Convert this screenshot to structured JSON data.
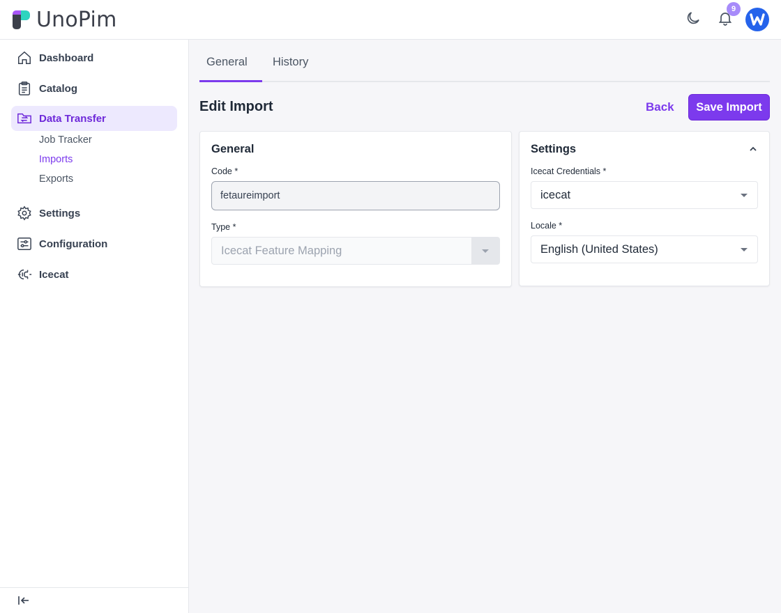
{
  "app": {
    "brand": "UnoPim",
    "notifications_count": "9"
  },
  "sidebar": {
    "items": [
      {
        "label": "Dashboard",
        "icon": "home-icon"
      },
      {
        "label": "Catalog",
        "icon": "clipboard-list-icon"
      },
      {
        "label": "Data Transfer",
        "icon": "folder-transfer-icon",
        "active": true
      },
      {
        "label": "Settings",
        "icon": "gear-icon"
      },
      {
        "label": "Configuration",
        "icon": "sliders-icon"
      },
      {
        "label": "Icecat",
        "icon": "icecat-plug-icon"
      }
    ],
    "sub_items": [
      {
        "label": "Job Tracker"
      },
      {
        "label": "Imports",
        "active": true
      },
      {
        "label": "Exports"
      }
    ]
  },
  "tabs": [
    {
      "label": "General",
      "active": true
    },
    {
      "label": "History"
    }
  ],
  "page": {
    "title": "Edit Import",
    "back_label": "Back",
    "save_label": "Save Import"
  },
  "general_card": {
    "title": "General",
    "code_label": "Code *",
    "code_value": "fetaureimport",
    "type_label": "Type *",
    "type_value": "Icecat Feature Mapping"
  },
  "settings_card": {
    "title": "Settings",
    "credentials_label": "Icecat Credentials *",
    "credentials_value": "icecat",
    "locale_label": "Locale *",
    "locale_value": "English (United States)"
  },
  "colors": {
    "accent": "#7c3aed",
    "accent_light": "#ede9fe",
    "badge": "#a78bfa",
    "avatar": "#2563eb"
  }
}
